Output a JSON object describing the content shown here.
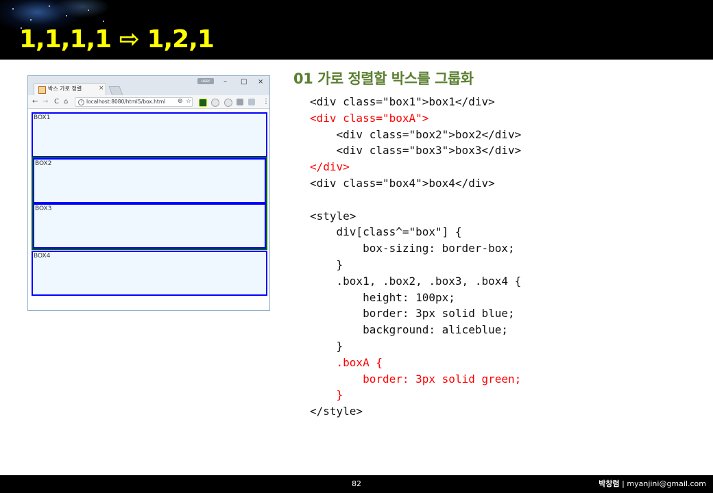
{
  "slide": {
    "title": "1,1,1,1 ⇨ 1,2,1",
    "page_number": "82",
    "author_name": "박창렴",
    "author_separator": " | ",
    "author_email": "myanjini@gmail.com"
  },
  "browser": {
    "tab_title": "박스 가로 정렬",
    "tab_close": "×",
    "user_badge": "user",
    "window_controls": {
      "minimize": "–",
      "maximize": "□",
      "close": "×"
    },
    "nav": {
      "back": "←",
      "forward": "→",
      "reload": "C",
      "home": "⌂"
    },
    "url": "localhost:8080/html5/box.html",
    "info_glyph": "i",
    "zoom_glyph": "⊕",
    "star_glyph": "☆",
    "menu_glyph": "⋮",
    "extension_icons": [
      "green-extension-icon",
      "clock-extension-icon",
      "gear-extension-icon",
      "s-extension-icon",
      "puzzle-extension-icon"
    ],
    "boxes": [
      "BOX1",
      "BOX2",
      "BOX3",
      "BOX4"
    ],
    "colors": {
      "box_border": "#0000ff",
      "box_background": "#f0f8ff",
      "group_border": "#006400"
    }
  },
  "section": {
    "title": "01 가로 정렬할 박스를 그룹화"
  },
  "code_lines": [
    {
      "text": "<div class=\"box1\">box1</div>",
      "highlight": false
    },
    {
      "text": "<div class=\"boxA\">",
      "highlight": true
    },
    {
      "text": "    <div class=\"box2\">box2</div>",
      "highlight": false
    },
    {
      "text": "    <div class=\"box3\">box3</div>",
      "highlight": false
    },
    {
      "text": "</div>",
      "highlight": true
    },
    {
      "text": "<div class=\"box4\">box4</div>",
      "highlight": false
    },
    {
      "text": "",
      "highlight": false
    },
    {
      "text": "<style>",
      "highlight": false
    },
    {
      "text": "    div[class^=\"box\"] {",
      "highlight": false
    },
    {
      "text": "        box-sizing: border-box;",
      "highlight": false
    },
    {
      "text": "    }",
      "highlight": false
    },
    {
      "text": "    .box1, .box2, .box3, .box4 {",
      "highlight": false
    },
    {
      "text": "        height: 100px;",
      "highlight": false
    },
    {
      "text": "        border: 3px solid blue;",
      "highlight": false
    },
    {
      "text": "        background: aliceblue;",
      "highlight": false
    },
    {
      "text": "    }",
      "highlight": false
    },
    {
      "text": "    .boxA {",
      "highlight": true
    },
    {
      "text": "        border: 3px solid green;",
      "highlight": true
    },
    {
      "text": "    }",
      "highlight": true
    },
    {
      "text": "</style>",
      "highlight": false
    }
  ],
  "colors": {
    "title": "#ffff00",
    "section_title": "#5b7f31",
    "highlight": "#ff0000",
    "header_background": "#000000"
  }
}
